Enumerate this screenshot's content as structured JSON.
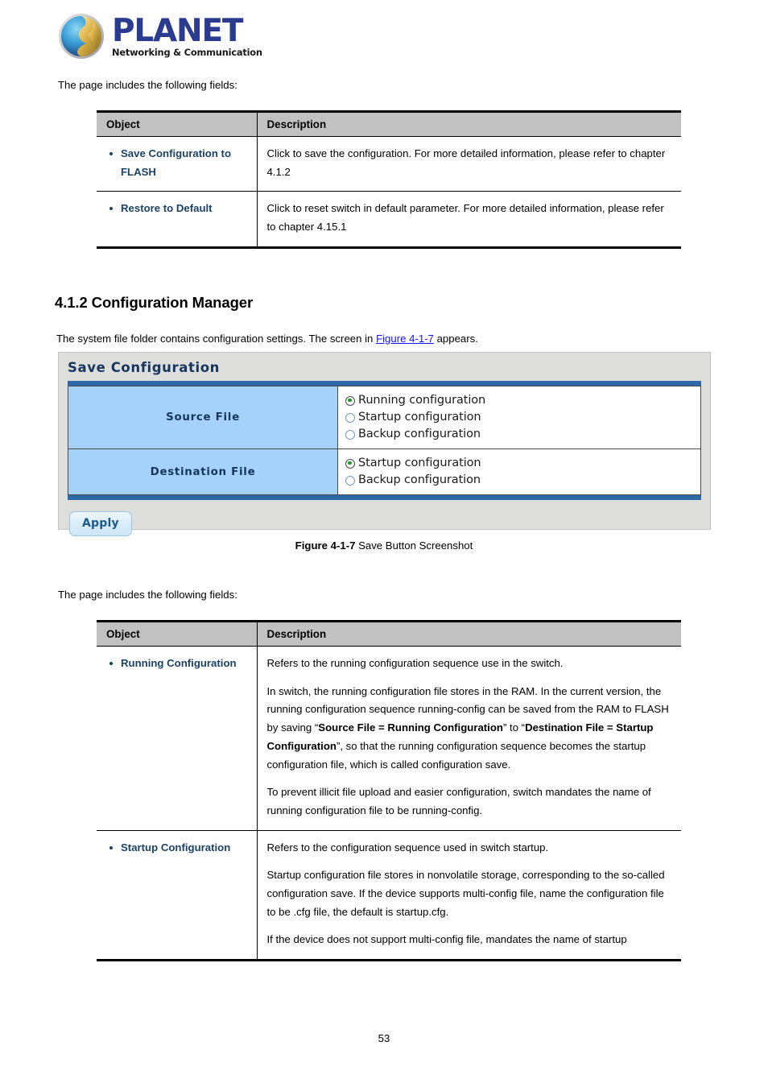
{
  "logo": {
    "brand": "PLANET",
    "tagline": "Networking & Communication",
    "icon": "globe-icon"
  },
  "intro_top": {
    "text": "The page includes the following fields:"
  },
  "table_top": {
    "headers": {
      "object": "Object",
      "description": "Description"
    },
    "rows": [
      {
        "object": "Save Configuration to FLASH",
        "description": "Click to save the configuration. For more detailed information, please refer to chapter 4.1.2"
      },
      {
        "object": "Restore to Default",
        "description": "Click to reset switch in default parameter. For more detailed information, please refer to chapter 4.15.1"
      }
    ]
  },
  "section": {
    "heading": "4.1.2 Configuration Manager",
    "intro_before_link": "The system file folder contains configuration settings. The screen in ",
    "intro_link": "Figure 4-1-7",
    "intro_after_link": " appears."
  },
  "panel": {
    "title": "Save Configuration",
    "rows": [
      {
        "label": "Source File",
        "options": [
          {
            "label": "Running configuration",
            "selected": true
          },
          {
            "label": "Startup configuration",
            "selected": false
          },
          {
            "label": "Backup configuration",
            "selected": false
          }
        ]
      },
      {
        "label": "Destination File",
        "options": [
          {
            "label": "Startup configuration",
            "selected": true
          },
          {
            "label": "Backup configuration",
            "selected": false
          }
        ]
      }
    ],
    "apply_label": "Apply"
  },
  "figure_caption": {
    "number": "Figure 4-1-7",
    "text": " Save Button Screenshot"
  },
  "intro_bottom": {
    "text": "The page includes the following fields:"
  },
  "table_bottom": {
    "headers": {
      "object": "Object",
      "description": "Description"
    },
    "rows": [
      {
        "object": "Running Configuration",
        "paragraphs": [
          [
            {
              "t": "Refers to the running configuration sequence use in the switch.",
              "b": false
            }
          ],
          [
            {
              "t": "In switch, the running configuration file stores in the RAM. In the current version, the running configuration sequence running-config can be saved from the RAM to FLASH by saving “",
              "b": false
            },
            {
              "t": "Source File = Running Configuration",
              "b": true
            },
            {
              "t": "” to “",
              "b": false
            },
            {
              "t": "Destination File = Startup Configuration",
              "b": true
            },
            {
              "t": "”, so that the running configuration sequence becomes the startup configuration file, which is called configuration save.",
              "b": false
            }
          ],
          [
            {
              "t": "To prevent illicit file upload and easier configuration, switch mandates the name of running configuration file to be running-config.",
              "b": false
            }
          ]
        ]
      },
      {
        "object": "Startup Configuration",
        "paragraphs": [
          [
            {
              "t": "Refers to the configuration sequence used in switch startup.",
              "b": false
            }
          ],
          [
            {
              "t": "Startup configuration file stores in nonvolatile storage, corresponding to the so-called configuration save. If the device supports multi-config file, name the configuration file to be .cfg file, the default is startup.cfg.",
              "b": false
            }
          ],
          [
            {
              "t": "If the device does not support multi-config file, mandates the name of startup",
              "b": false
            }
          ]
        ]
      }
    ]
  },
  "page_number": "53",
  "colors": {
    "link": "#1414ff",
    "object_blue": "#1b4368",
    "panel_title": "#17365d",
    "panel_bg": "#dededd",
    "cell_blue": "#a4d2fb",
    "accent_bar": "#2f6aa8",
    "table_header_gray": "#c1c1c1",
    "radio_selected": "#1f9b2e"
  }
}
